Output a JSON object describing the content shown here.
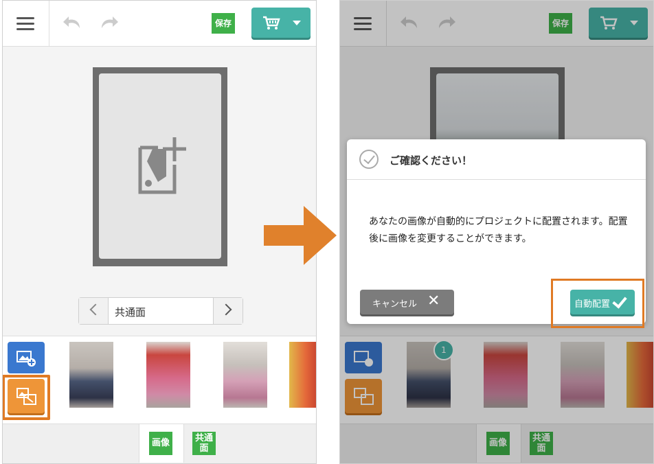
{
  "toolbar": {
    "save_label": "保存"
  },
  "pager": {
    "label": "共通面"
  },
  "tabs": {
    "image": "画像",
    "common_line1": "共通",
    "common_line2": "面"
  },
  "dialog": {
    "title": "ご確認ください！",
    "message": "あなたの画像が自動的にプロジェクトに配置されます。配置後に画像を変更することができます。",
    "cancel_label": "キャンセル",
    "confirm_label": "自動配置"
  },
  "thumbnails": {
    "selected_count": "1"
  },
  "icons": [
    "menu-icon",
    "undo-icon",
    "redo-icon",
    "cart-icon",
    "add-image-icon",
    "auto-place-icon",
    "check-circle-icon",
    "close-icon",
    "checkmark-icon"
  ],
  "colors": {
    "save_green": "#3fb049",
    "teal": "#47b3a7",
    "orange_highlight": "#e07a24",
    "auto_place_orange": "#ee9538",
    "add_image_blue": "#3a78cf",
    "cancel_gray": "#7c7c7c"
  }
}
